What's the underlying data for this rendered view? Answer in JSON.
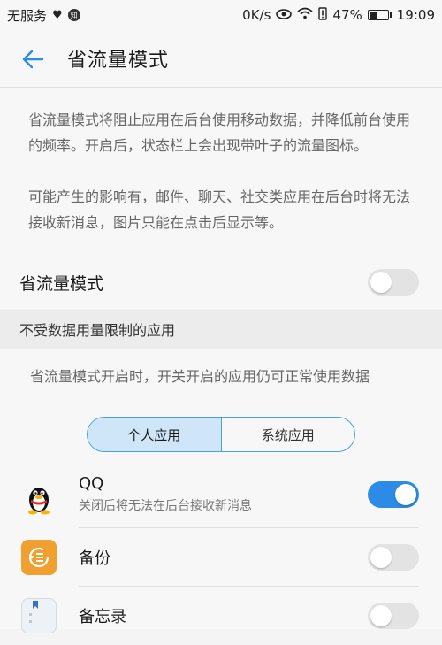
{
  "status_bar": {
    "carrier": "无服务",
    "speed": "0K/s",
    "battery": "47%",
    "time": "19:09",
    "icons": [
      "heartbeat-icon",
      "notification-icon",
      "eye-icon",
      "wifi-icon",
      "battery-alert-icon",
      "battery-icon"
    ]
  },
  "header": {
    "back_icon": "back-arrow-icon",
    "title": "省流量模式"
  },
  "description": {
    "p1": "省流量模式将阻止应用在后台使用移动数据，并降低前台使用的频率。开启后，状态栏上会出现带叶子的流量图标。",
    "p2": "可能产生的影响有，邮件、聊天、社交类应用在后台时将无法接收新消息，图片只能在点击后显示等。"
  },
  "main_toggle": {
    "label": "省流量模式",
    "state": "off"
  },
  "section": {
    "title": "不受数据用量限制的应用",
    "description": "省流量模式开启时，开关开启的应用仍可正常使用数据"
  },
  "segments": {
    "personal": "个人应用",
    "system": "系统应用",
    "selected": "personal"
  },
  "apps": [
    {
      "name": "QQ",
      "subtitle": "关闭后将无法在后台接收新消息",
      "icon": "qq-penguin-icon",
      "enabled": true
    },
    {
      "name": "备份",
      "subtitle": "",
      "icon": "backup-icon",
      "enabled": false
    },
    {
      "name": "备忘录",
      "subtitle": "",
      "icon": "notepad-icon",
      "enabled": false
    }
  ],
  "colors": {
    "accent": "#2b8be6",
    "toggle_off": "#e3e3e3",
    "segment_active": "#cfe6f8",
    "backup_icon_bg": "#f0a030"
  }
}
